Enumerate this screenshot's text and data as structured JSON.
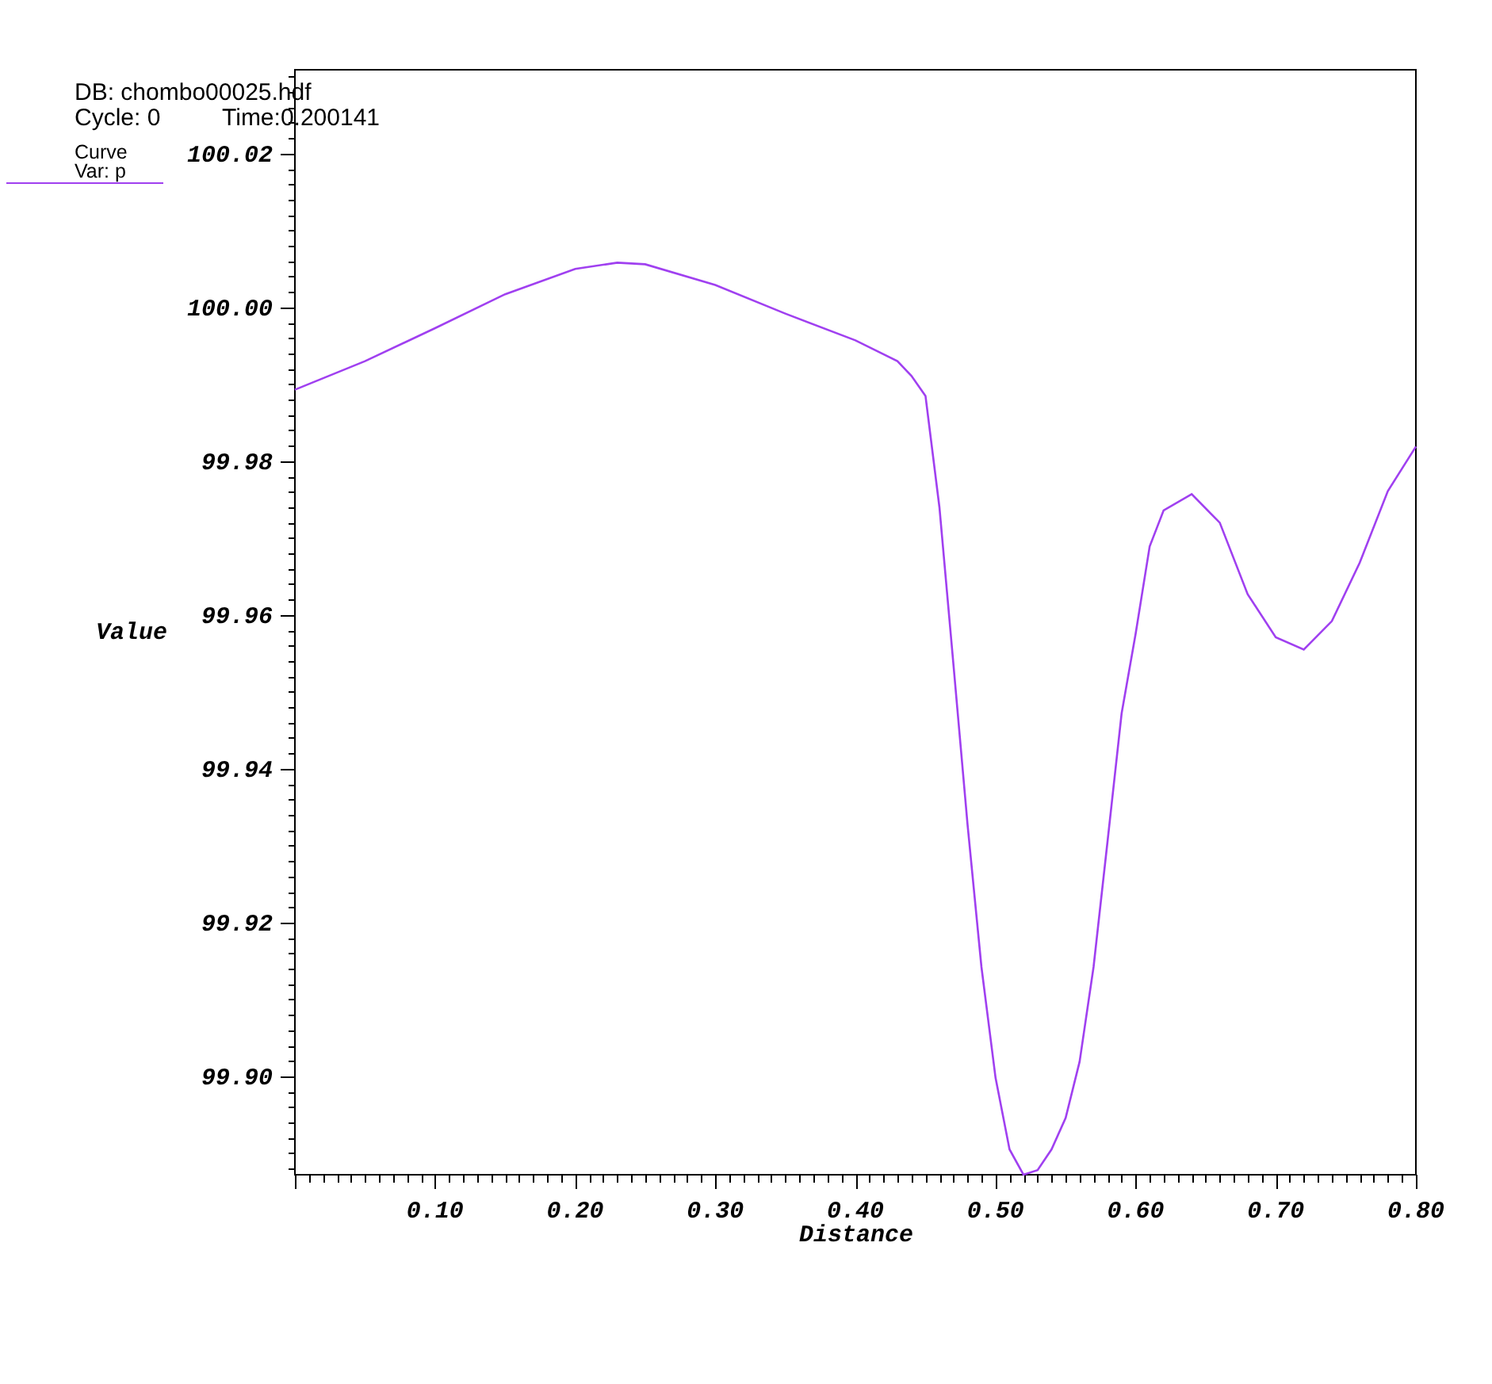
{
  "header": {
    "database": "DB: chombo00025.hdf",
    "cycle": "Cycle: 0",
    "time": "Time:0.200141"
  },
  "legend": {
    "title": "Curve",
    "variable": "Var: p"
  },
  "chart_data": {
    "type": "line",
    "xlabel": "Distance",
    "ylabel": "Value",
    "x": [
      0,
      0.05,
      0.1,
      0.15,
      0.2,
      0.23,
      0.25,
      0.3,
      0.35,
      0.4,
      0.43,
      0.44,
      0.45,
      0.46,
      0.47,
      0.48,
      0.49,
      0.5,
      0.51,
      0.52,
      0.53,
      0.54,
      0.55,
      0.56,
      0.57,
      0.58,
      0.59,
      0.6,
      0.61,
      0.62,
      0.64,
      0.66,
      0.68,
      0.7,
      0.72,
      0.74,
      0.76,
      0.78,
      0.8
    ],
    "series": [
      {
        "color": "#a040f0",
        "values": [
          99.9893,
          99.993,
          99.9973,
          100.0017,
          100.005,
          100.0058,
          100.0056,
          100.0029,
          99.9992,
          99.9957,
          99.993,
          99.9911,
          99.9885,
          99.974,
          99.9534,
          99.9328,
          99.9142,
          99.8998,
          99.8905,
          99.8872,
          99.8878,
          99.8905,
          99.8946,
          99.9019,
          99.9142,
          99.9307,
          99.9472,
          99.9575,
          99.9689,
          99.9736,
          99.9757,
          99.972,
          99.9627,
          99.9571,
          99.9555,
          99.9592,
          99.9668,
          99.9761,
          99.9819
        ]
      }
    ],
    "xlim": [
      0,
      0.8
    ],
    "ylim": [
      99.8872,
      100.0309
    ],
    "xticks": [
      {
        "value": 0.1,
        "label": "0.10"
      },
      {
        "value": 0.2,
        "label": "0.20"
      },
      {
        "value": 0.3,
        "label": "0.30"
      },
      {
        "value": 0.4,
        "label": "0.40"
      },
      {
        "value": 0.5,
        "label": "0.50"
      },
      {
        "value": 0.6,
        "label": "0.60"
      },
      {
        "value": 0.7,
        "label": "0.70"
      },
      {
        "value": 0.8,
        "label": "0.80"
      }
    ],
    "yticks": [
      {
        "value": 99.9,
        "label": "99.90"
      },
      {
        "value": 99.92,
        "label": "99.92"
      },
      {
        "value": 99.94,
        "label": "99.94"
      },
      {
        "value": 99.96,
        "label": "99.96"
      },
      {
        "value": 99.98,
        "label": "99.98"
      },
      {
        "value": 100,
        "label": "100.00"
      },
      {
        "value": 100.02,
        "label": "100.02"
      }
    ]
  }
}
